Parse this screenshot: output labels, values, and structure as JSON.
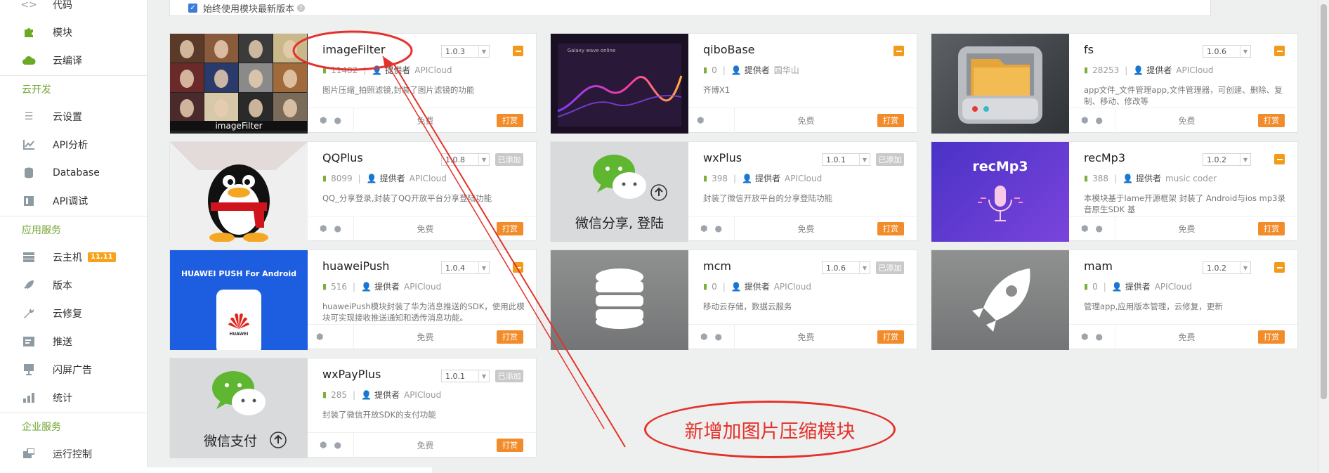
{
  "sidebar": {
    "items": [
      {
        "label": "代码",
        "icon": "code-icon"
      },
      {
        "label": "模块",
        "icon": "puzzle-icon"
      },
      {
        "label": "云编译",
        "icon": "cloud-icon"
      }
    ],
    "groups": [
      {
        "title": "云开发",
        "items": [
          {
            "label": "云设置",
            "icon": "sliders-icon"
          },
          {
            "label": "API分析",
            "icon": "chart-icon"
          },
          {
            "label": "Database",
            "icon": "database-icon"
          },
          {
            "label": "API调试",
            "icon": "debug-icon"
          }
        ]
      },
      {
        "title": "应用服务",
        "items": [
          {
            "label": "云主机",
            "icon": "server-icon",
            "badge": "11.11"
          },
          {
            "label": "版本",
            "icon": "rocket-icon"
          },
          {
            "label": "云修复",
            "icon": "wrench-icon"
          },
          {
            "label": "推送",
            "icon": "push-icon"
          },
          {
            "label": "闪屏广告",
            "icon": "ad-icon"
          },
          {
            "label": "统计",
            "icon": "bars-icon"
          }
        ]
      },
      {
        "title": "企业服务",
        "items": [
          {
            "label": "运行控制",
            "icon": "control-icon"
          }
        ]
      }
    ]
  },
  "topbar": {
    "checkbox_label": "始终使用模块最新版本"
  },
  "footer_labels": {
    "price": "免费",
    "buy": "打赏",
    "added": "已添加",
    "provider": "提供者"
  },
  "modules": [
    {
      "name": "imageFilter",
      "version": "1.0.3",
      "downloads": "11482",
      "provider": "APICloud",
      "desc": "图片压缩_拍照滤镜,封装了图片滤镜的功能",
      "added": false,
      "thumb_caption": "imageFilter"
    },
    {
      "name": "qiboBase",
      "version": "",
      "downloads": "0",
      "provider": "国华山",
      "desc": "齐博X1",
      "added": false,
      "thumb_caption": "Galaxy wave online"
    },
    {
      "name": "fs",
      "version": "1.0.6",
      "downloads": "28253",
      "provider": "APICloud",
      "desc": "app文件_文件管理app,文件管理器，可创建、删除、复制、移动、修改等",
      "added": false
    },
    {
      "name": "QQPlus",
      "version": "1.0.8",
      "downloads": "8099",
      "provider": "APICloud",
      "desc": "QQ_分享登录,封装了QQ开放平台分享登陆功能",
      "added": true
    },
    {
      "name": "wxPlus",
      "version": "1.0.1",
      "downloads": "398",
      "provider": "APICloud",
      "desc": "封装了微信开放平台的分享登陆功能",
      "added": true,
      "thumb_caption": "微信分享, 登陆"
    },
    {
      "name": "recMp3",
      "version": "1.0.2",
      "downloads": "388",
      "provider": "music coder",
      "desc": "本模块基于lame开源框架 封装了 Android与ios mp3录音原生SDK 基",
      "added": false,
      "thumb_caption": "recMp3"
    },
    {
      "name": "huaweiPush",
      "version": "1.0.4",
      "downloads": "516",
      "provider": "APICloud",
      "desc": "huaweiPush模块封装了华为消息推送的SDK，使用此模块可实现接收推送通知和透传消息功能。",
      "added": false,
      "thumb_caption": "HUAWEI PUSH For Android",
      "thumb_brand": "HUAWEI"
    },
    {
      "name": "mcm",
      "version": "1.0.6",
      "downloads": "0",
      "provider": "APICloud",
      "desc": "移动云存储，数据云服务",
      "added": true
    },
    {
      "name": "mam",
      "version": "1.0.2",
      "downloads": "0",
      "provider": "APICloud",
      "desc": "管理app,应用版本管理，云修复，更新",
      "added": false
    },
    {
      "name": "wxPayPlus",
      "version": "1.0.1",
      "downloads": "285",
      "provider": "APICloud",
      "desc": "封装了微信开放SDK的支付功能",
      "added": true,
      "thumb_caption": "微信支付"
    }
  ],
  "annotation": {
    "text": "新增加图片压缩模块",
    "color": "#e4322b"
  },
  "colors": {
    "accent_green": "#72a632",
    "buy_orange": "#f28c2a",
    "action_orange": "#f29a1a"
  }
}
